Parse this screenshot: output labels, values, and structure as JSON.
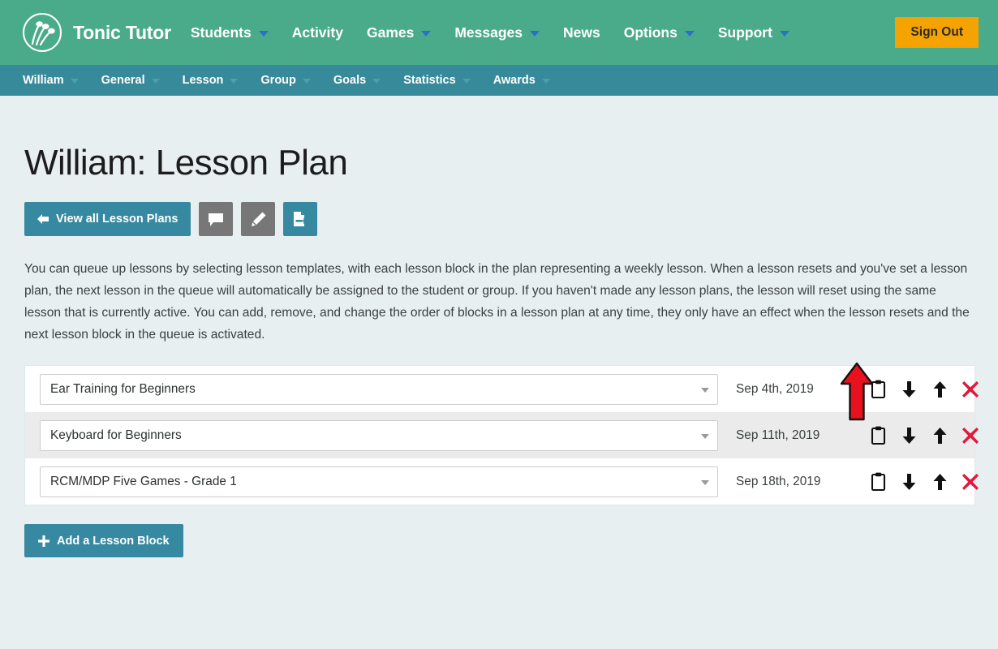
{
  "header": {
    "logo_icon": "tonic-tutor-logo",
    "brand": "Tonic Tutor",
    "nav": [
      {
        "label": "Students",
        "has_caret": true
      },
      {
        "label": "Activity",
        "has_caret": false
      },
      {
        "label": "Games",
        "has_caret": true
      },
      {
        "label": "Messages",
        "has_caret": true
      },
      {
        "label": "News",
        "has_caret": false
      },
      {
        "label": "Options",
        "has_caret": true
      },
      {
        "label": "Support",
        "has_caret": true
      }
    ],
    "sign_out": "Sign Out",
    "bg_color": "#4aab8a",
    "sign_out_color": "#f5a300"
  },
  "subnav": {
    "items": [
      {
        "label": "William",
        "has_caret": true
      },
      {
        "label": "General",
        "has_caret": true
      },
      {
        "label": "Lesson",
        "has_caret": true
      },
      {
        "label": "Group",
        "has_caret": true
      },
      {
        "label": "Goals",
        "has_caret": true
      },
      {
        "label": "Statistics",
        "has_caret": true
      },
      {
        "label": "Awards",
        "has_caret": true
      }
    ],
    "bg_color": "#378a99"
  },
  "main": {
    "title": "William: Lesson Plan",
    "toolbar": {
      "back_label": "View all Lesson Plans",
      "back_icon": "arrow-left-icon",
      "comment_icon": "speech-bubble-icon",
      "edit_icon": "pencil-icon",
      "export_icon": "document-export-icon"
    },
    "intro": "You can queue up lessons by selecting lesson templates, with each lesson block in the plan representing a weekly lesson. When a lesson resets and you've set a lesson plan, the next lesson in the queue will automatically be assigned to the student or group. If you haven't made any lesson plans, the lesson will reset using the same lesson that is currently active. You can add, remove, and change the order of blocks in a lesson plan at any time, they only have an effect when the lesson resets and the next lesson block in the queue is activated.",
    "rows": [
      {
        "lesson": "Ear Training for Beginners",
        "date": "Sep 4th, 2019",
        "actions": [
          "clipboard-icon",
          "move-down-icon",
          "move-up-icon",
          "delete-icon"
        ]
      },
      {
        "lesson": "Keyboard for Beginners",
        "date": "Sep 11th, 2019",
        "actions": [
          "clipboard-icon",
          "move-down-icon",
          "move-up-icon",
          "delete-icon"
        ]
      },
      {
        "lesson": "RCM/MDP Five Games - Grade 1",
        "date": "Sep 18th, 2019",
        "actions": [
          "clipboard-icon",
          "move-down-icon",
          "move-up-icon",
          "delete-icon"
        ]
      }
    ],
    "add_label": "Add a Lesson Block",
    "add_icon": "plus-icon",
    "delete_color": "#e2183c",
    "accent_color": "#3689a0"
  },
  "annotation": {
    "arrow_icon": "red-up-arrow-annotation",
    "color": "#e8121f",
    "points_at": "clipboard-icon-row-1"
  }
}
